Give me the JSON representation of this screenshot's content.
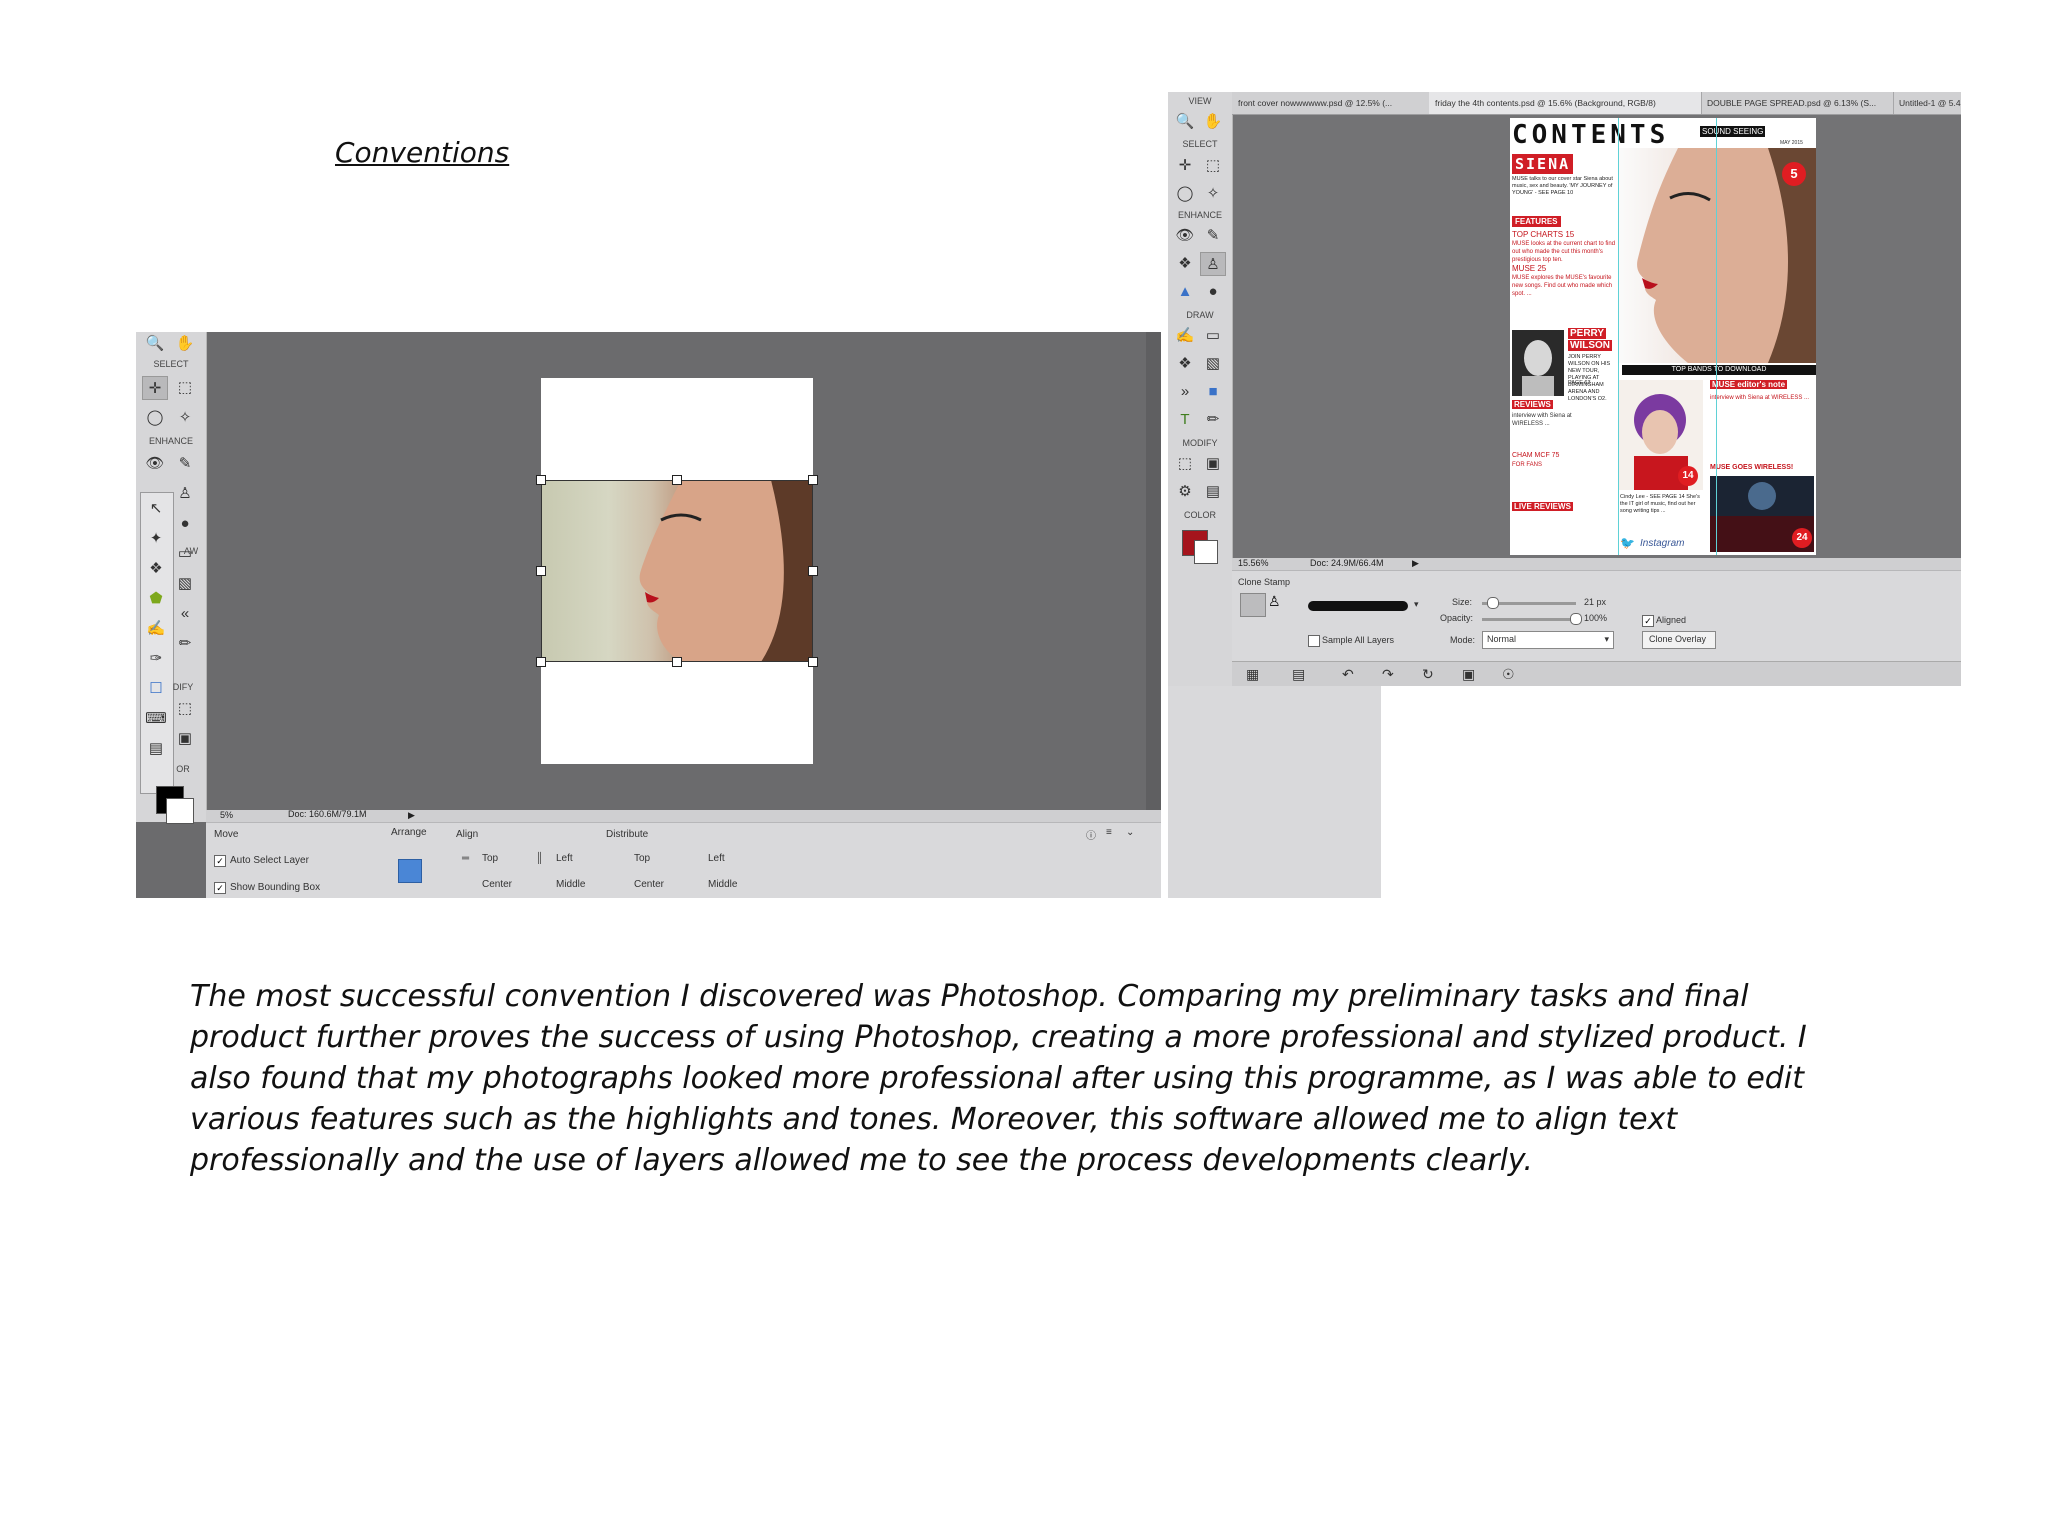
{
  "page": {
    "title": "Conventions",
    "paragraph": "The most successful convention I discovered was Photoshop. Comparing my preliminary tasks and final product further proves the success of using Photoshop, creating a more professional and stylized product. I also found that my photographs looked more professional after using this programme, as I was able to edit various features such as the highlights and tones. Moreover, this software allowed me to align text professionally and the use of layers allowed me to see the process developments clearly."
  },
  "screenshot_left": {
    "toolbox": {
      "select_label": "SELECT",
      "enhance_label": "ENHANCE",
      "draw_label": "AW",
      "modify_label": "DIFY",
      "color_label": "OR"
    },
    "status": {
      "zoom": "5%",
      "doc": "Doc: 160.6M/79.1M"
    },
    "options": {
      "move_label": "Move",
      "arrange_label": "Arrange",
      "align_label": "Align",
      "distribute_label": "Distribute",
      "auto_select": "Auto Select Layer",
      "show_bounding": "Show Bounding Box",
      "align_top": "Top",
      "align_left": "Left",
      "align_center": "Center",
      "align_middle": "Middle",
      "dist_top": "Top",
      "dist_left": "Left",
      "dist_center": "Center",
      "dist_middle": "Middle"
    },
    "colors": {
      "foreground": "#000000",
      "background": "#ffffff"
    }
  },
  "screenshot_right": {
    "toolbox": {
      "view_label": "VIEW",
      "select_label": "SELECT",
      "enhance_label": "ENHANCE",
      "draw_label": "DRAW",
      "modify_label": "MODIFY",
      "color_label": "COLOR"
    },
    "tabs": [
      "front cover nowwwwww.psd @ 12.5% (...",
      "friday the 4th contents.psd @ 15.6% (Background, RGB/8)",
      "DOUBLE PAGE SPREAD.psd @ 6.13% (S...",
      "Untitled-1 @ 5.4"
    ],
    "status": {
      "zoom": "15.56%",
      "doc": "Doc: 24.9M/66.4M"
    },
    "options": {
      "tool_name": "Clone Stamp",
      "size_label": "Size:",
      "size_value": "21 px",
      "opacity_label": "Opacity:",
      "opacity_value": "100%",
      "mode_label": "Mode:",
      "mode_value": "Normal",
      "sample_all": "Sample All Layers",
      "aligned": "Aligned",
      "clone_overlay": "Clone Overlay"
    },
    "colors": {
      "foreground": "#a5141c",
      "background": "#ffffff"
    },
    "magazine": {
      "header": "CONTENTS",
      "header_side": "SOUND SEEING",
      "header_date": "MAY 2015",
      "siena": "SIENA",
      "siena_text": "MUSE talks to our cover star Siena about music, sex and beauty. 'MY JOURNEY of YOUNG' - SEE PAGE 10",
      "features": "FEATURES",
      "top_charts": "TOP CHARTS 15",
      "top_charts_text": "MUSE looks at the current chart to find out who made the cut this month's prestigious top ten.",
      "muse_25": "MUSE 25",
      "muse_25_text": "MUSE explores the MUSE's favourite new songs. Find out who made which spot. ...",
      "perry": "PERRY",
      "wilson": "WILSON",
      "perry_text": "JOIN PERRY WILSON ON HIS NEW TOUR, PLAYING AT BIRMINGHAM ARENA AND LONDON'S O2.",
      "perry_page": "PAGE 63",
      "top_banner": "TOP BANDS TO DOWNLOAD",
      "reviews": "REVIEWS",
      "muse_editor": "MUSE editor's note",
      "cindy_caption": "Cindy Lee - SEE PAGE 14 She's the IT girl of music, find out her song writing tips ...",
      "instagram": "Instagram",
      "muse_wireless": "MUSE GOES WIRELESS!",
      "badge_main": "5",
      "badge_cindy": "14",
      "badge_concert": "24",
      "chart_text": "CHAM MCF 75",
      "for_fans": "FOR FANS",
      "live_review": "LIVE REVIEWS",
      "more_text": "interview with Siena at WIRELESS ..."
    }
  }
}
